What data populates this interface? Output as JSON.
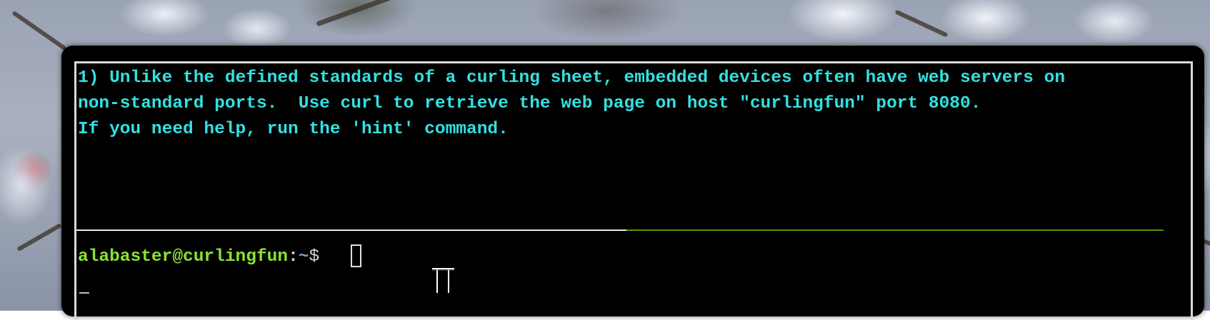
{
  "terminal": {
    "objective_lines": [
      "1) Unlike the defined standards of a curling sheet, embedded devices often have web servers on",
      "non-standard ports.  Use curl to retrieve the web page on host \"curlingfun\" port 8080.",
      "If you need help, run the 'hint' command."
    ],
    "prompt": {
      "user_host": "alabaster@curlingfun",
      "separator": ":",
      "path": "~",
      "symbol": "$"
    },
    "colors": {
      "objective_text": "#34e0e0",
      "prompt_user": "#8ae234",
      "prompt_path": "#729fcf",
      "divider_right": "#4e9a06",
      "background": "#000000"
    }
  },
  "icons": {
    "cursor": "block-cursor-icon",
    "mouse": "ibeam-mouse-icon"
  }
}
